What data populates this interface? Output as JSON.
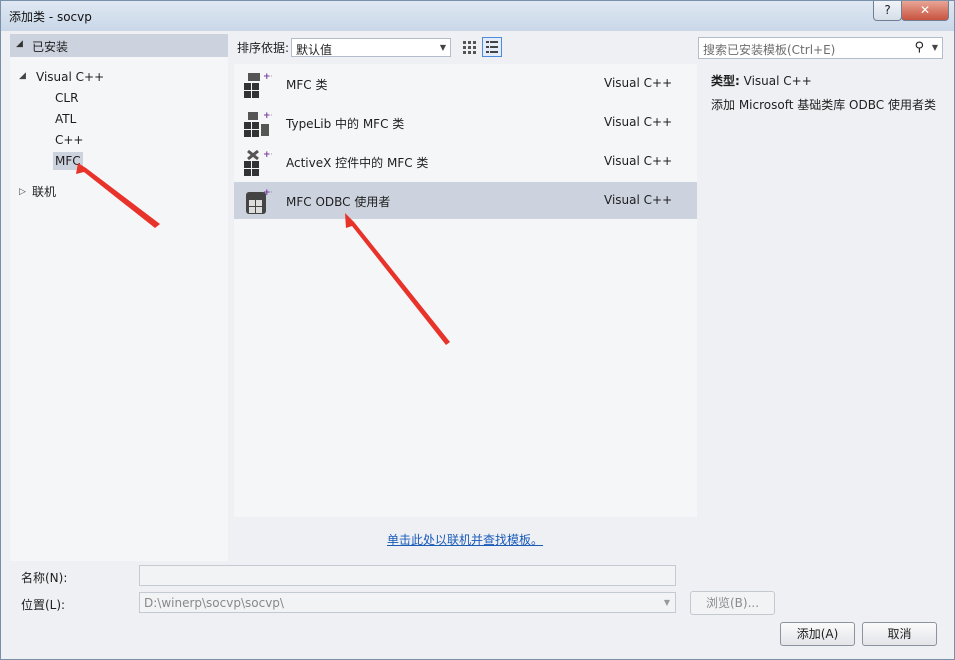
{
  "window": {
    "title": "添加类 - socvp",
    "help": "?",
    "close": "✕"
  },
  "tree": {
    "installed": "已安装",
    "visual_cpp": "Visual C++",
    "children": [
      "CLR",
      "ATL",
      "C++",
      "MFC"
    ],
    "online": "联机"
  },
  "toolbar": {
    "sort_label": "排序依据:",
    "sort_value": "默认值"
  },
  "templates": [
    {
      "name": "MFC 类",
      "lang": "Visual C++"
    },
    {
      "name": "TypeLib 中的 MFC 类",
      "lang": "Visual C++"
    },
    {
      "name": "ActiveX 控件中的 MFC 类",
      "lang": "Visual C++"
    },
    {
      "name": "MFC ODBC 使用者",
      "lang": "Visual C++"
    }
  ],
  "online_link": "单击此处以联机并查找模板。",
  "search": {
    "placeholder": "搜索已安装模板(Ctrl+E)"
  },
  "details": {
    "type_label": "类型:",
    "type_value": "Visual C++",
    "description": "添加 Microsoft 基础类库 ODBC 使用者类"
  },
  "fields": {
    "name_label": "名称(N):",
    "name_value": "",
    "location_label": "位置(L):",
    "location_value": "D:\\winerp\\socvp\\socvp\\"
  },
  "buttons": {
    "browse": "浏览(B)...",
    "add": "添加(A)",
    "cancel": "取消"
  },
  "colors": {
    "accent": "#1a5bb8",
    "selection": "#cdd3de",
    "annotation_arrow": "#e8332a"
  }
}
